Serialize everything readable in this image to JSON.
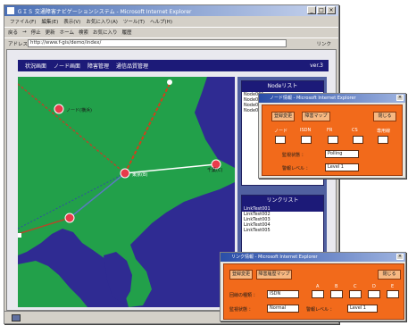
{
  "browser": {
    "title": "ＧＩＳ 交通障害ナビゲーションシステム - Microsoft Internet Explorer",
    "menu": [
      "ファイル(F)",
      "編集(E)",
      "表示(V)",
      "お気に入り(A)",
      "ツール(T)",
      "ヘルプ(H)"
    ],
    "toolbar": [
      "戻る",
      "→",
      "停止",
      "更新",
      "ホーム",
      "検索",
      "お気に入り",
      "履歴"
    ],
    "address_label": "アドレス(D)",
    "address_value": "http://www.f-gis/demo/index/",
    "go_label": "リンク"
  },
  "app": {
    "menu": [
      "状況画面",
      "ノード画面",
      "障害管理",
      "通信品質管理"
    ],
    "version": "ver.3"
  },
  "map": {
    "labels": [
      "ノード(横浜)",
      "東京(B)",
      "千葉(C)"
    ]
  },
  "panels": {
    "node_list_title": "Nodeリスト",
    "node_list": [
      "Node001",
      "Node002",
      "Node003",
      "Node004"
    ],
    "link_list_title": "リンクリスト",
    "link_list": [
      "LinkTest001",
      "LinkTest002",
      "LinkTest003",
      "LinkTest004",
      "LinkTest005"
    ]
  },
  "dialog_node": {
    "title": "ノード情報 - Microsoft Internet Explorer",
    "btn_save": "登録変更",
    "btn_map": "障害マップ",
    "btn_close": "閉じる",
    "col_labels": [
      "ノード",
      "ISDN",
      "FR",
      "CS",
      "専用線"
    ],
    "status_label": "監視状態 ：",
    "status_value": "Polling",
    "level_label": "警報レベル ：",
    "level_value": "Level 1"
  },
  "dialog_link": {
    "title": "リンク情報 - Microsoft Internet Explorer",
    "btn_save": "登録変更",
    "btn_map": "障害履歴マップ",
    "btn_close": "閉じる",
    "col_labels": [
      "A",
      "B",
      "C",
      "D",
      "E"
    ],
    "name_label": "回線の種類 ：",
    "name_value": "ISDN",
    "status_label": "監視状態 ：",
    "status_value": "Normal",
    "level_label": "警報レベル ：",
    "level_value": "Level 1"
  },
  "colors": {
    "header": "#1c1a78",
    "land": "#22a04a",
    "sea": "#2f2b92",
    "dialog": "#f26a1b",
    "node": "#e83b4b"
  }
}
